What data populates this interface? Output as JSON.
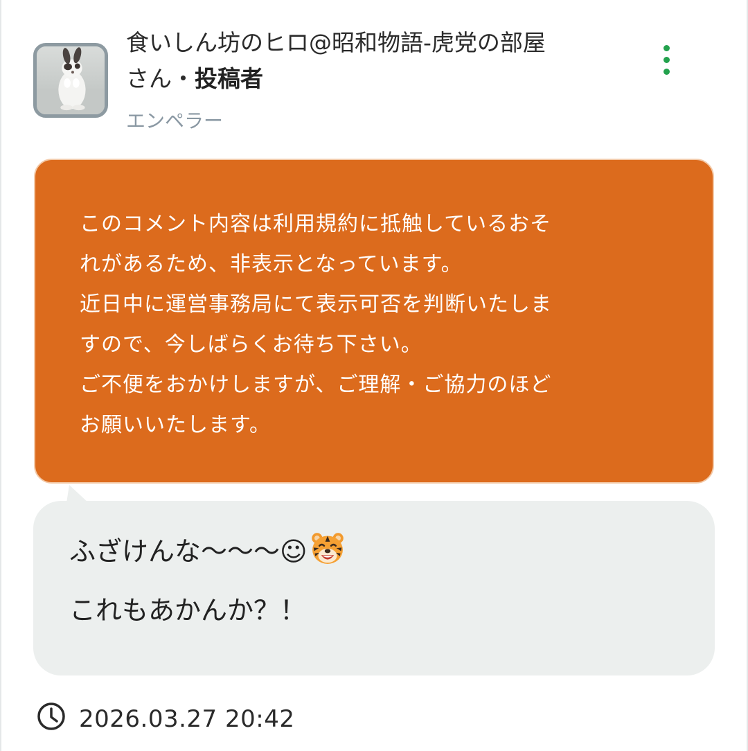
{
  "header": {
    "author_name": "食いしん坊のヒロ@昭和物語-虎党の部屋",
    "author_suffix": "さん",
    "separator": "・",
    "role_label": "投稿者",
    "title_badge": "エンペラー",
    "menu_icon": "more-vertical-icon",
    "menu_color": "#23a24d",
    "avatar_icon": "rabbit-avatar"
  },
  "warning": {
    "background_color": "#dc6b1d",
    "lines": [
      "このコメント内容は利用規約に抵触しているおそ",
      "れがあるため、非表示となっています。",
      "近日中に運営事務局にて表示可否を判断いたしま",
      "すので、今しばらくお待ち下さい。",
      "ご不便をおかけしますが、ご理解・ご協力のほど",
      "お願いいたします。"
    ]
  },
  "comment": {
    "line1": "ふざけんな〜〜〜☺",
    "line1_emoji": "tiger-face-icon",
    "line2": "これもあかんか？！",
    "bubble_color": "#ecefee"
  },
  "footer": {
    "clock_icon": "clock-icon",
    "timestamp": "2026.03.27 20:42"
  }
}
